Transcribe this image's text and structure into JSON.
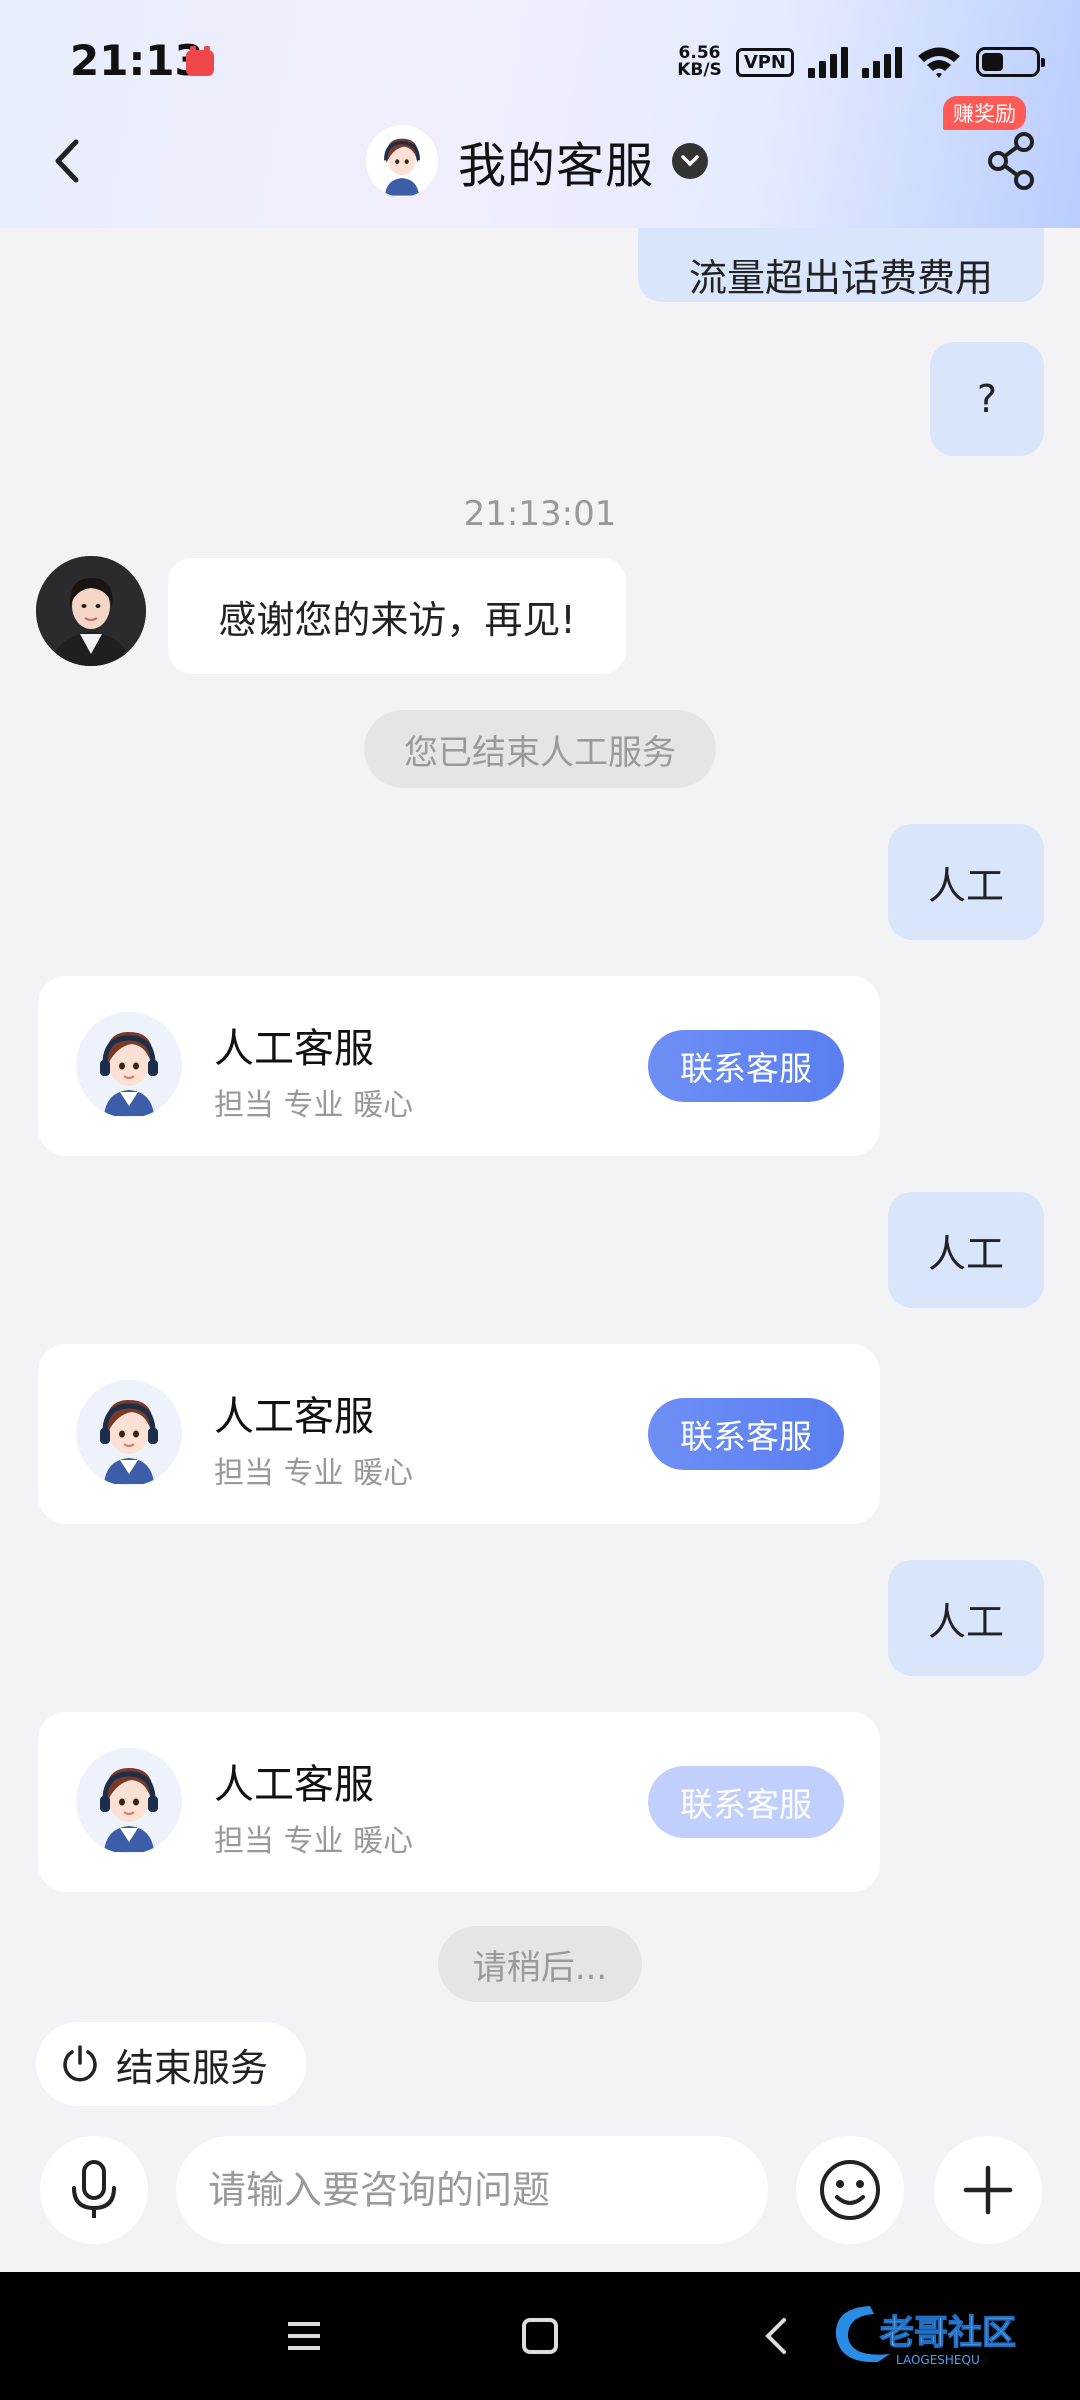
{
  "status_bar": {
    "time": "21:13",
    "net_speed_value": "6.56",
    "net_speed_unit": "KB/S",
    "vpn": "VPN",
    "battery_level": 0.4
  },
  "header": {
    "title": "我的客服",
    "reward_badge": "赚奖励",
    "icons": [
      "back-icon",
      "chevron-down-icon",
      "share-icon"
    ]
  },
  "chat": {
    "partial_message": "流量超出话费费用",
    "user_question": "?",
    "timestamp": "21:13:01",
    "agent_message": "感谢您的来访，再见!",
    "system_end_notice": "您已结束人工服务",
    "user_message_1": "人工",
    "user_message_2": "人工",
    "user_message_3": "人工",
    "cards": [
      {
        "title": "人工客服",
        "subtitle": "担当 专业 暖心",
        "button": "联系客服",
        "enabled": true
      },
      {
        "title": "人工客服",
        "subtitle": "担当 专业 暖心",
        "button": "联系客服",
        "enabled": true
      },
      {
        "title": "人工客服",
        "subtitle": "担当 专业 暖心",
        "button": "联系客服",
        "enabled": false
      }
    ],
    "waiting_notice": "请稍后..."
  },
  "actions": {
    "end_service": "结束服务"
  },
  "input": {
    "placeholder": "请输入要咨询的问题",
    "value": "",
    "icons": [
      "microphone-icon",
      "emoji-icon",
      "plus-icon"
    ]
  },
  "nav_bar": {
    "icons": [
      "menu-icon",
      "home-icon",
      "back-nav-icon"
    ],
    "watermark": "老哥社区",
    "watermark_sub": "LAOGESHEQU"
  },
  "colors": {
    "accent": "#5a7ef0",
    "accent_disabled": "#c0cffb",
    "outgoing_bubble": "#d9e5fb",
    "badge": "#ff5a55",
    "background": "#f3f3f5"
  }
}
